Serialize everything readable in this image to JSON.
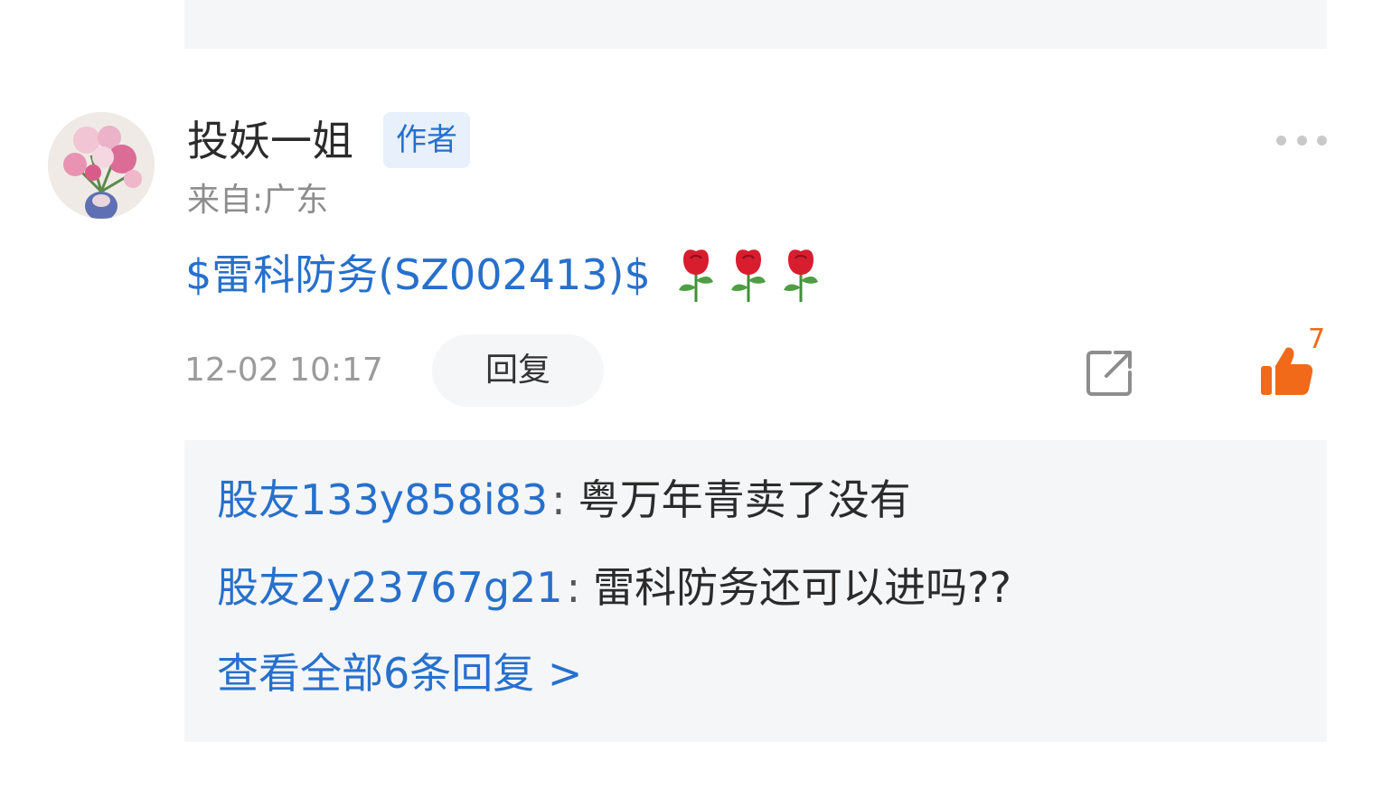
{
  "colors": {
    "link_blue": "#2770cc",
    "like_orange": "#f06a1a",
    "text_dark": "#2b2b2b",
    "text_gray": "#8d8d8d",
    "panel_bg": "#f5f6f8"
  },
  "comment": {
    "author": {
      "name": "投妖一姐",
      "badge": "作者",
      "location": "来自:广东",
      "avatar_icon": "avatar-flower-vase"
    },
    "content": {
      "stock_link": "$雷科防务(SZ002413)$",
      "emoji": [
        "rose-emoji",
        "rose-emoji",
        "rose-emoji"
      ]
    },
    "timestamp": "12-02 10:17",
    "reply_label": "回复",
    "like_count": "7",
    "more_icon": "more-dots-icon",
    "share_icon": "share-icon",
    "like_icon": "thumbs-up-icon"
  },
  "replies": [
    {
      "user": "股友133y858i83",
      "colon": ":",
      "text": "粤万年青卖了没有"
    },
    {
      "user": "股友2y23767g21",
      "colon": ":",
      "text": "雷科防务还可以进吗??"
    }
  ],
  "view_all": "查看全部6条回复 >"
}
